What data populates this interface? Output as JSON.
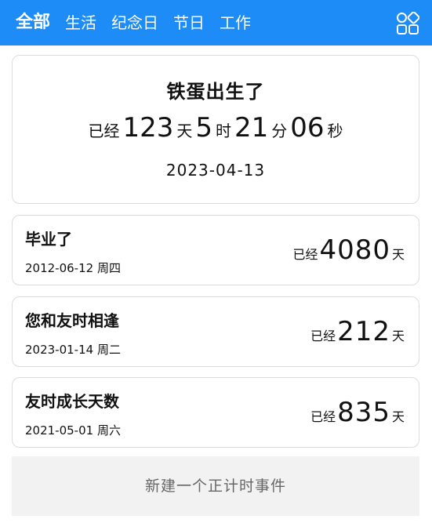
{
  "header": {
    "tabs": [
      {
        "label": "全部",
        "active": true
      },
      {
        "label": "生活",
        "active": false
      },
      {
        "label": "纪念日",
        "active": false
      },
      {
        "label": "节日",
        "active": false
      },
      {
        "label": "工作",
        "active": false
      }
    ],
    "menu_icon": "grid-icon",
    "accent_color": "#1d8cf7"
  },
  "featured": {
    "title": "铁蛋出生了",
    "prefix": "已经",
    "days": "123",
    "days_unit": "天",
    "hours": "5",
    "hours_unit": "时",
    "minutes": "21",
    "minutes_unit": "分",
    "seconds": "06",
    "seconds_unit": "秒",
    "date": "2023-04-13"
  },
  "events": [
    {
      "title": "毕业了",
      "date": "2012-06-12 周四",
      "prefix": "已经",
      "count": "4080",
      "unit": "天"
    },
    {
      "title": "您和友时相逢",
      "date": "2023-01-14 周二",
      "prefix": "已经",
      "count": "212",
      "unit": "天"
    },
    {
      "title": "友时成长天数",
      "date": "2021-05-01 周六",
      "prefix": "已经",
      "count": "835",
      "unit": "天"
    }
  ],
  "new_event_button": "新建一个正计时事件"
}
